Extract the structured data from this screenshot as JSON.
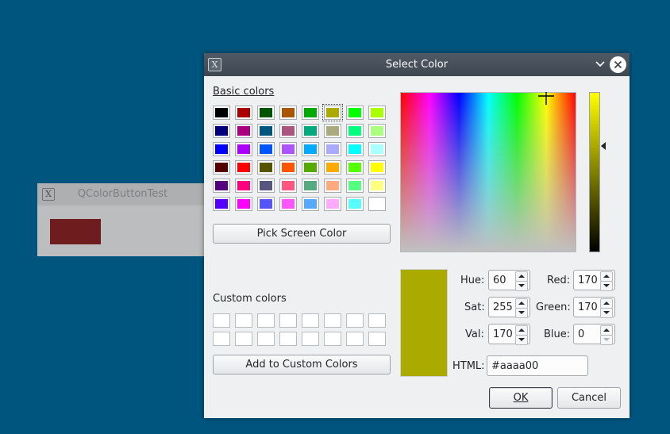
{
  "background_window": {
    "title": "QColorButtonTest",
    "icon": "x11-app-icon",
    "swatch_color": "#6f1c1f"
  },
  "dialog": {
    "title": "Select Color",
    "icon": "x11-app-icon",
    "basic_colors_label": "Basic colors",
    "basic_colors": [
      [
        "#000000",
        "#aa0000",
        "#005500",
        "#aa5500",
        "#00aa00",
        "#aaaa00",
        "#00ff00",
        "#aaff00"
      ],
      [
        "#00007f",
        "#aa007f",
        "#00557f",
        "#aa557f",
        "#00aa7f",
        "#aaaa7f",
        "#00ff7f",
        "#aaff7f"
      ],
      [
        "#0000ff",
        "#aa00ff",
        "#0055ff",
        "#aa55ff",
        "#00aaff",
        "#aaaaff",
        "#00ffff",
        "#aaffff"
      ],
      [
        "#550000",
        "#ff0000",
        "#555500",
        "#ff5500",
        "#55aa00",
        "#ffaa00",
        "#55ff00",
        "#ffff00"
      ],
      [
        "#55007f",
        "#ff007f",
        "#55557f",
        "#ff557f",
        "#55aa7f",
        "#ffaa7f",
        "#55ff7f",
        "#ffff7f"
      ],
      [
        "#5500ff",
        "#ff00ff",
        "#5555ff",
        "#ff55ff",
        "#55aaff",
        "#ffaaff",
        "#55ffff",
        "#ffffff"
      ]
    ],
    "selected_basic_color": "#aaaa00",
    "pick_screen_color_label": "Pick Screen Color",
    "custom_colors_label": "Custom colors",
    "add_custom_label": "Add to Custom Colors",
    "current_color": "#aaaa00",
    "fields": {
      "hue_label": "Hue:",
      "hue": "60",
      "sat_label": "Sat:",
      "sat": "255",
      "val_label": "Val:",
      "val": "170",
      "red_label": "Red:",
      "red": "170",
      "green_label": "Green:",
      "green": "170",
      "blue_label": "Blue:",
      "blue": "0",
      "html_label": "HTML:",
      "html": "#aaaa00"
    },
    "ok_label": "OK",
    "cancel_label": "Cancel"
  }
}
